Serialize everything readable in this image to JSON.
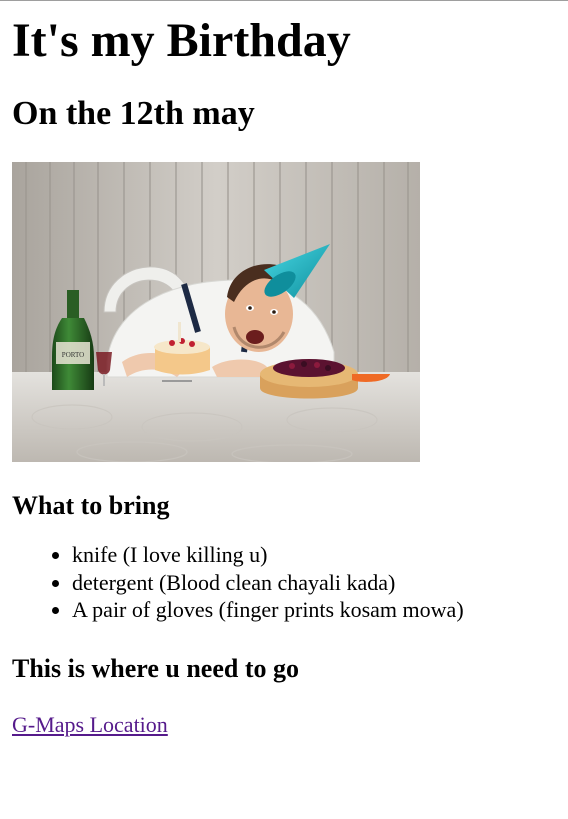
{
  "header": {
    "title": "It's my Birthday",
    "subtitle": "On the 12th may"
  },
  "photo": {
    "description_icon": "birthday-photo",
    "bottle_label_text": "PORTO",
    "colors": {
      "curtain": "#c9c4bd",
      "tablecloth": "#d9d6d1",
      "party_hat": "#1fb6c6",
      "shirt": "#f3f3f3",
      "bottle": "#2f6b2a"
    }
  },
  "bring": {
    "heading": "What to bring",
    "items": [
      "knife (I love killing u)",
      "detergent (Blood clean chayali kada)",
      "A pair of gloves (finger prints kosam mowa)"
    ]
  },
  "location": {
    "heading": "This is where u need to go",
    "link_label": "G-Maps Location",
    "link_color": "#551a8b"
  }
}
